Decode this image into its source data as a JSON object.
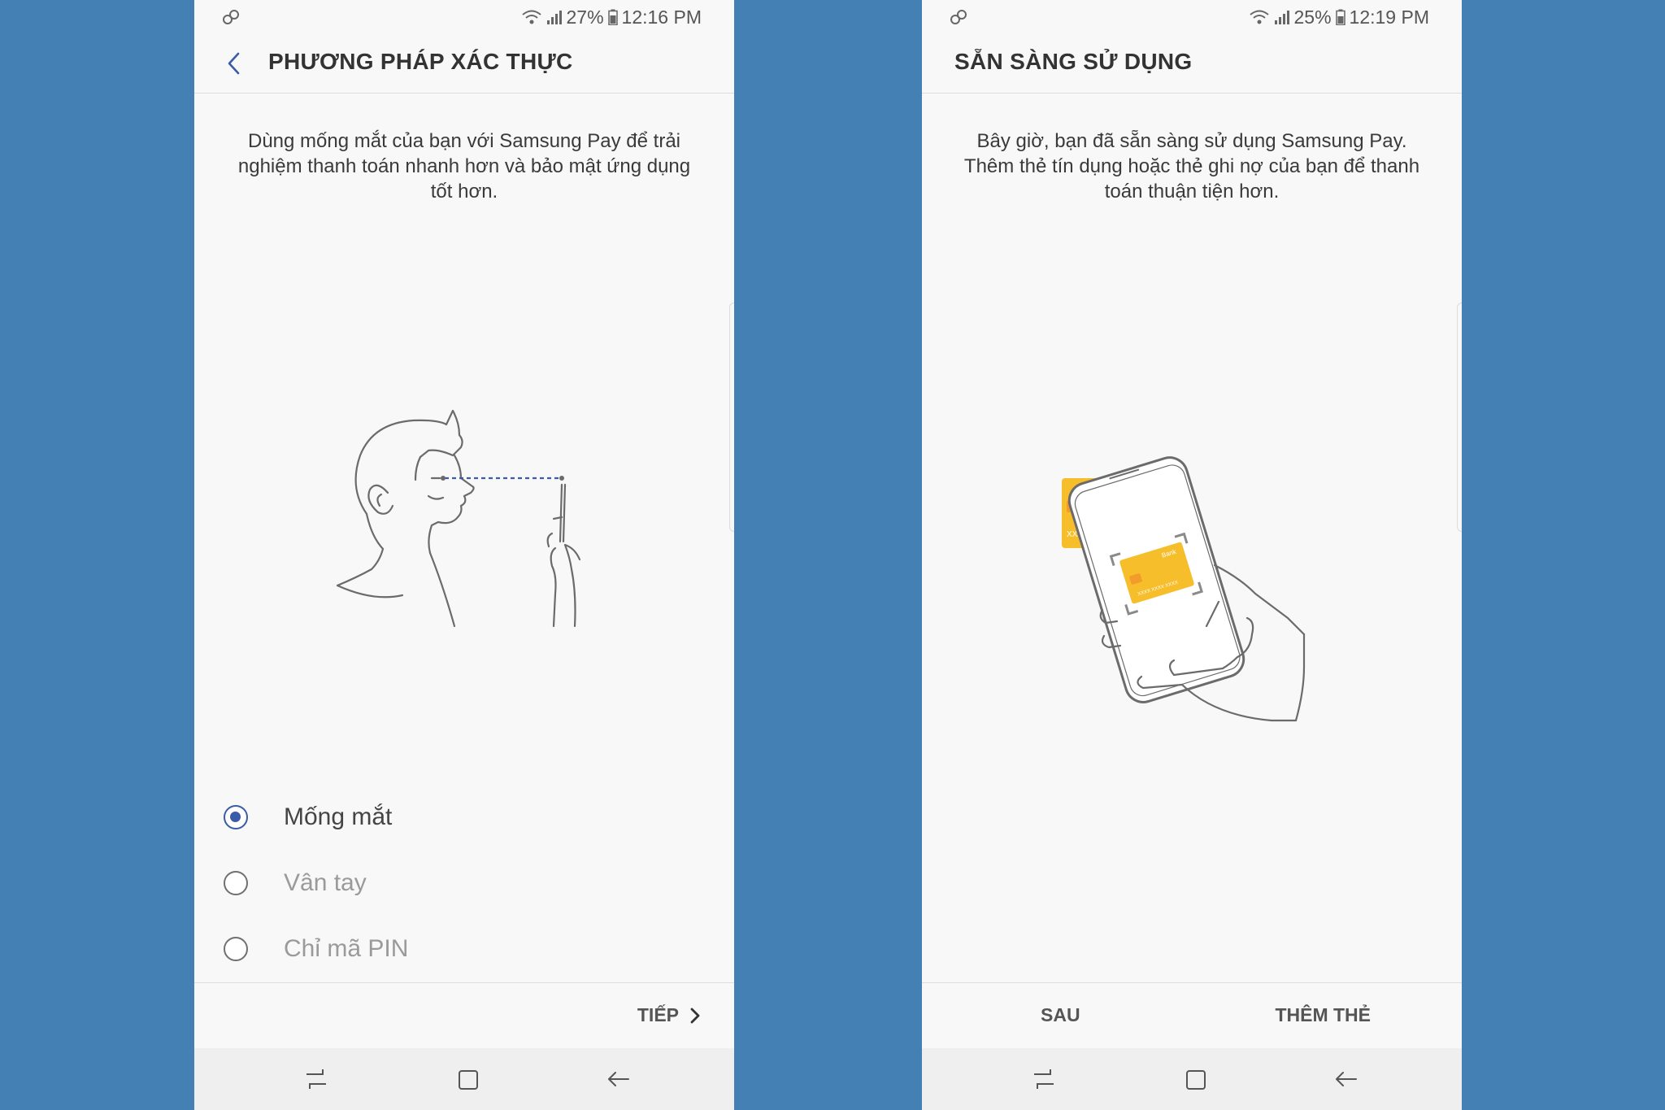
{
  "colors": {
    "background": "#4580B4",
    "accent": "#3A5BA8",
    "card": "#F7BE2B",
    "card_chip": "#F39C2A"
  },
  "left_screen": {
    "status": {
      "link_icon": "link-icon",
      "wifi_icon": "wifi-icon",
      "signal_icon": "signal-icon",
      "battery_text": "27%",
      "battery_icon": "battery-icon",
      "time": "12:16 PM"
    },
    "title": "PHƯƠNG PHÁP XÁC THỰC",
    "back_icon": "back-arrow-icon",
    "description": "Dùng mống mắt của bạn với Samsung Pay để trải nghiệm thanh toán nhanh hơn và bảo mật ứng dụng tốt hơn.",
    "illustration": "iris-scan-illustration",
    "options": [
      {
        "label": "Mống mắt",
        "selected": true
      },
      {
        "label": "Vân tay",
        "selected": false
      },
      {
        "label": "Chỉ mã PIN",
        "selected": false
      }
    ],
    "next_label": "TIẾP",
    "next_icon": "chevron-right-icon"
  },
  "right_screen": {
    "status": {
      "link_icon": "link-icon",
      "wifi_icon": "wifi-icon",
      "signal_icon": "signal-icon",
      "battery_text": "25%",
      "battery_icon": "battery-icon",
      "time": "12:19 PM"
    },
    "title": "SẴN SÀNG SỬ DỤNG",
    "description": "Bây giờ, bạn đã sẵn sàng sử dụng Samsung Pay. Thêm thẻ tín dụng hoặc thẻ ghi nợ của bạn để thanh toán thuận tiện hơn.",
    "illustration": "card-scan-illustration",
    "card_text": {
      "back_card": "XXXX",
      "front_card_bank": "Bank",
      "front_card_number": "XXXX XXXX XXXX"
    },
    "later_label": "SAU",
    "add_card_label": "THÊM THẺ"
  },
  "navbar": {
    "recent_icon": "recent-apps-icon",
    "home_icon": "home-icon",
    "back_icon": "back-icon"
  }
}
